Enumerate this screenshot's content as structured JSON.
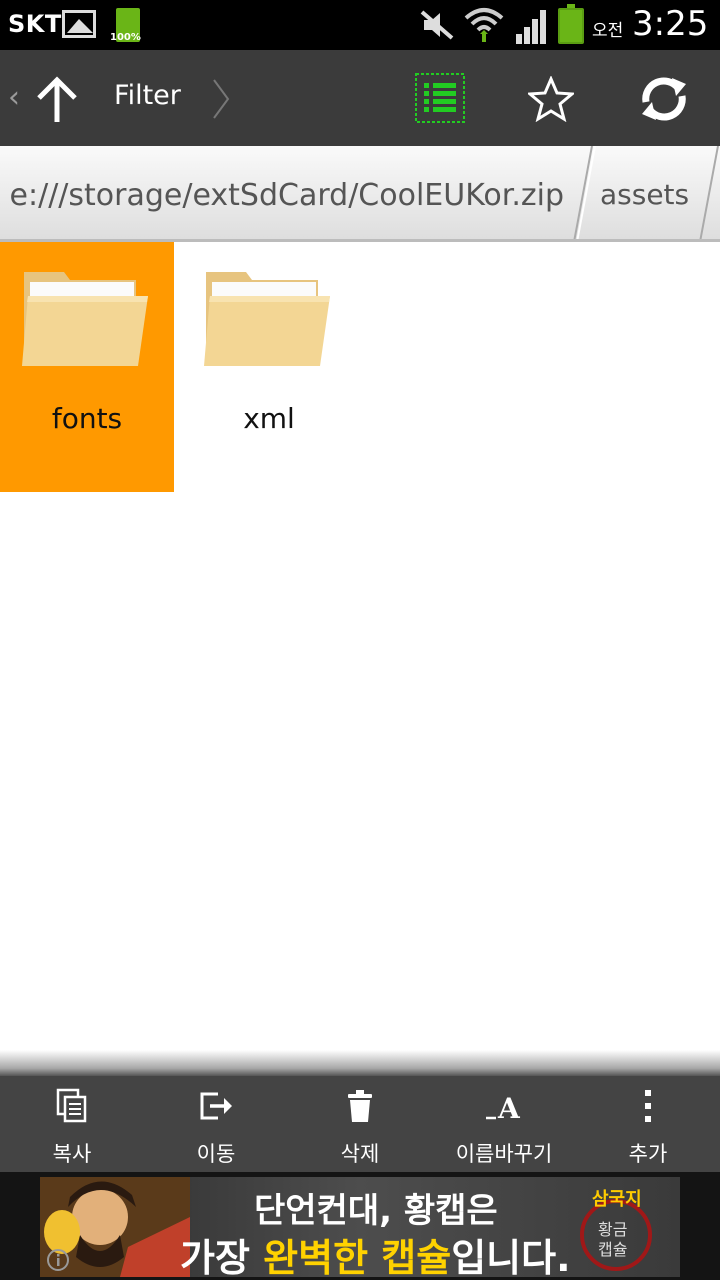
{
  "status": {
    "carrier": "SKT",
    "battery_small": "100%",
    "ampm": "오전",
    "time": "3:25"
  },
  "actionbar": {
    "title": "Filter",
    "icons": [
      "up-arrow-icon",
      "list-view-icon",
      "star-icon",
      "refresh-icon"
    ]
  },
  "path": {
    "crumbs": [
      "e:///storage/extSdCard/CoolEUKor.zip",
      "assets"
    ]
  },
  "files": [
    {
      "name": "fonts",
      "selected": true
    },
    {
      "name": "xml",
      "selected": false
    }
  ],
  "toolbar": {
    "items": [
      {
        "label": "복사",
        "icon": "copy-icon"
      },
      {
        "label": "이동",
        "icon": "move-icon"
      },
      {
        "label": "삭제",
        "icon": "trash-icon"
      },
      {
        "label": "이름바꾸기",
        "icon": "rename-icon"
      },
      {
        "label": "추가",
        "icon": "more-icon"
      }
    ]
  },
  "ad": {
    "line1": "단언컨대, 황캡은",
    "line2_a": "가장 ",
    "line2_b": "완벽한 캡슐",
    "line2_c": "입니다.",
    "logo_top": "삼국지",
    "logo_bottom": "황금캡슐"
  },
  "colors": {
    "selected": "#ff9900",
    "actionbar": "#3b3b3b",
    "toolbar": "#444444",
    "accent_green": "#22cc22"
  }
}
